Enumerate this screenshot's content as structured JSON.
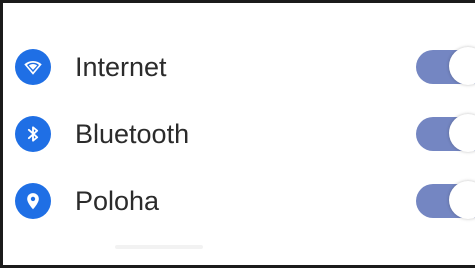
{
  "settings": {
    "items": [
      {
        "label": "Internet",
        "icon": "wifi-icon",
        "enabled": true
      },
      {
        "label": "Bluetooth",
        "icon": "bluetooth-icon",
        "enabled": true
      },
      {
        "label": "Poloha",
        "icon": "location-pin-icon",
        "enabled": true
      }
    ]
  },
  "colors": {
    "icon_background": "#1f6fe5",
    "toggle_track": "#7486c2",
    "text": "#2b2b2b"
  }
}
